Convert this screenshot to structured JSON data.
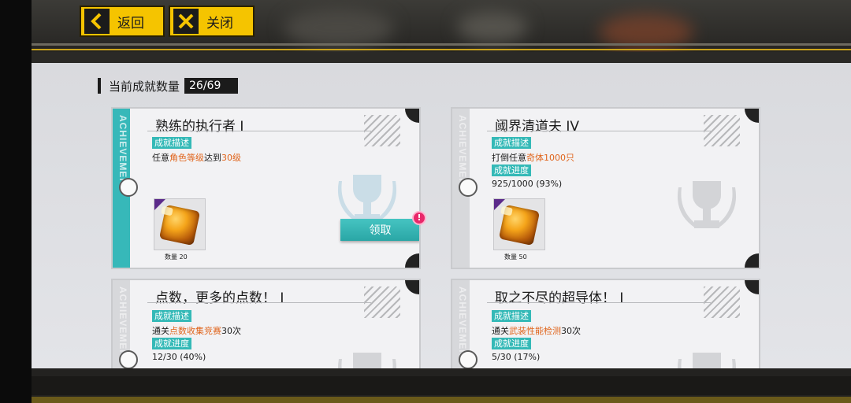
{
  "nav": {
    "back_label": "返回",
    "close_label": "关闭"
  },
  "summary": {
    "label": "当前成就数量",
    "value": "26/69"
  },
  "cards": [
    {
      "title": "熟练的执行者 I",
      "side_text": "ACHIEVEMENT",
      "desc_tag": "成就描述",
      "desc_pre": "任意",
      "desc_hl1": "角色等级",
      "desc_mid": "达到",
      "desc_hl2": "30级",
      "desc_post": "",
      "reward_qty": "数量 20",
      "claim_label": "领取",
      "alert": "!"
    },
    {
      "title": "阈界清道夫 IV",
      "side_text": "ACHIEVEMENT",
      "desc_tag": "成就描述",
      "desc_pre": "打倒任意",
      "desc_hl1": "奇体1000只",
      "desc_post": "",
      "progress_tag": "成就进度",
      "progress": "925/1000 (93%)",
      "reward_qty": "数量 50"
    },
    {
      "title": "点数，更多的点数！ I",
      "side_text": "ACHIEVEMENT",
      "desc_tag": "成就描述",
      "desc_pre": "通关",
      "desc_hl1": "点数收集竞赛",
      "desc_post": "30次",
      "progress_tag": "成就进度",
      "progress": "12/30 (40%)"
    },
    {
      "title": "取之不尽的超导体！ I",
      "side_text": "ACHIEVEMENT",
      "desc_tag": "成就描述",
      "desc_pre": "通关",
      "desc_hl1": "武装性能检测",
      "desc_post": "30次",
      "progress_tag": "成就进度",
      "progress": "5/30 (17%)"
    }
  ],
  "colors": {
    "nav_yellow": "#f5c400",
    "teal": "#34b9b7",
    "highlight_orange": "#e0641b",
    "alert_pink": "#e8286a"
  }
}
